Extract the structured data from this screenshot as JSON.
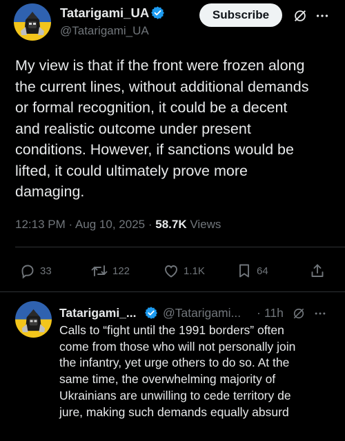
{
  "main_post": {
    "author_name": "Tatarigami_UA",
    "author_handle": "@Tatarigami_UA",
    "subscribe_label": "Subscribe",
    "text": "My view is that if the front were frozen along\nthe current lines, without additional demands\nor formal recognition, it could be a decent\nand realistic outcome under present\nconditions. However, if sanctions would be\nlifted, it could ultimately prove more\ndamaging.",
    "time": "12:13 PM",
    "date": "Aug 10, 2025",
    "views_count": "58.7K",
    "views_label": "Views",
    "replies": "33",
    "reposts": "122",
    "likes": "1.1K",
    "bookmarks": "64"
  },
  "reply_post": {
    "author_name": "Tatarigami_...",
    "author_handle": "@Tatarigami...",
    "time_ago": "11h",
    "text": "Calls to “fight until the 1991 borders” often\ncome from those who will not personally join\nthe infantry, yet urge others to do so. At the\nsame time, the overwhelming majority of\nUkrainians are unwilling to cede territory de\njure, making such demands equally absurd"
  },
  "icons": [
    "verified-badge-icon",
    "grok-icon",
    "more-icon",
    "reply-icon",
    "repost-icon",
    "like-icon",
    "bookmark-icon",
    "share-icon"
  ],
  "colors": {
    "background": "#000000",
    "text": "#e7e9ea",
    "muted": "#71767b",
    "verified": "#1d9bf0",
    "divider": "#2f3336"
  }
}
